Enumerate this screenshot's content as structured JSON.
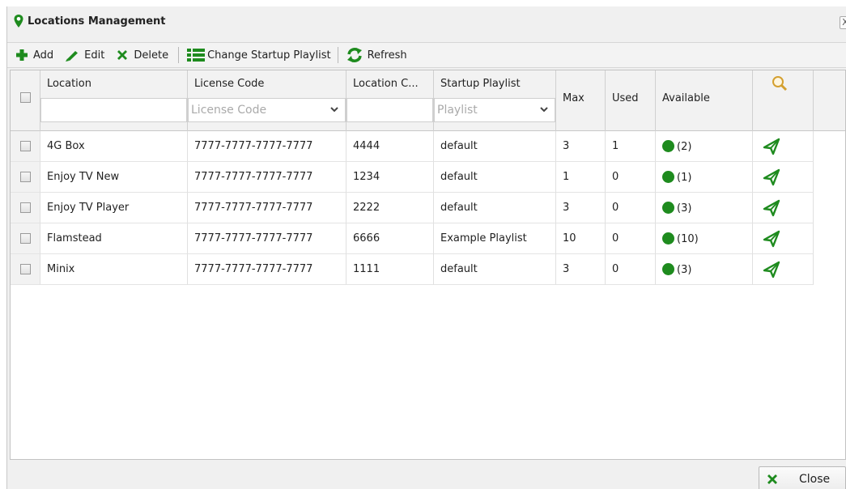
{
  "window": {
    "title": "Locations Management",
    "close_glyph": "X"
  },
  "toolbar": {
    "add_label": "Add",
    "edit_label": "Edit",
    "delete_label": "Delete",
    "change_playlist_label": "Change Startup Playlist",
    "refresh_label": "Refresh"
  },
  "columns": {
    "location": "Location",
    "license_code": "License Code",
    "location_code": "Location C...",
    "startup_playlist": "Startup Playlist",
    "max": "Max",
    "used": "Used",
    "available": "Available"
  },
  "filters": {
    "license_code_placeholder": "License Code",
    "playlist_placeholder": "Playlist"
  },
  "rows": [
    {
      "location": "4G Box",
      "license": "7777-7777-7777-7777",
      "code": "4444",
      "playlist": "default",
      "max": "3",
      "used": "1",
      "available": "(2)"
    },
    {
      "location": "Enjoy TV New",
      "license": "7777-7777-7777-7777",
      "code": "1234",
      "playlist": "default",
      "max": "1",
      "used": "0",
      "available": "(1)"
    },
    {
      "location": "Enjoy TV Player",
      "license": "7777-7777-7777-7777",
      "code": "2222",
      "playlist": "default",
      "max": "3",
      "used": "0",
      "available": "(3)"
    },
    {
      "location": "Flamstead",
      "license": "7777-7777-7777-7777",
      "code": "6666",
      "playlist": "Example Playlist",
      "max": "10",
      "used": "0",
      "available": "(10)"
    },
    {
      "location": "Minix",
      "license": "7777-7777-7777-7777",
      "code": "1111",
      "playlist": "default",
      "max": "3",
      "used": "0",
      "available": "(3)"
    }
  ],
  "footer": {
    "close_label": "Close"
  },
  "colors": {
    "accent_green": "#1e8b1e",
    "search_icon": "#d4a030"
  },
  "icons": {
    "title": "map-pin-icon",
    "add": "plus-icon",
    "edit": "pencil-icon",
    "delete": "x-icon",
    "change_playlist": "list-icon",
    "refresh": "refresh-icon",
    "search": "search-icon",
    "row_action": "send-icon",
    "available_status": "status-dot-icon"
  }
}
